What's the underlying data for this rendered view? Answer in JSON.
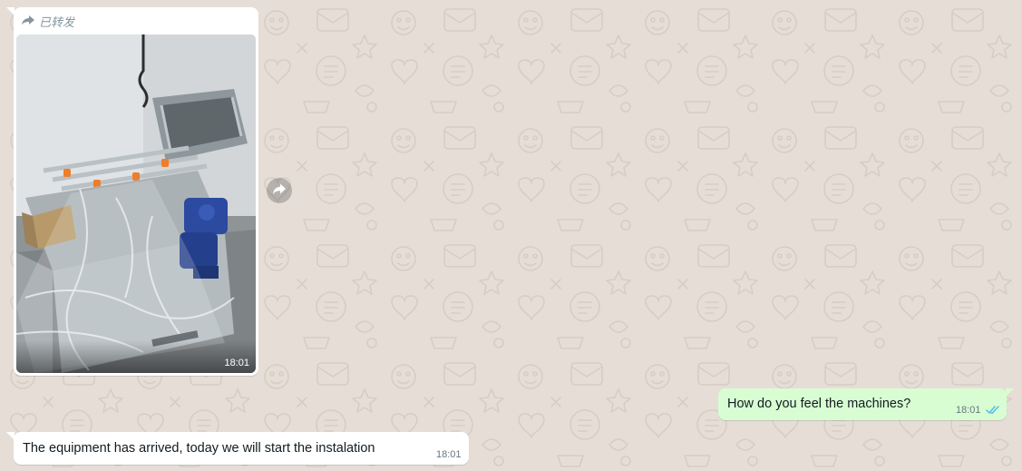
{
  "colors": {
    "wallpaper": "#e6ded6",
    "incoming_bubble": "#ffffff",
    "outgoing_bubble": "#d9fdd3",
    "read_ticks": "#53bdeb",
    "meta_text": "#8696a0"
  },
  "messages": [
    {
      "direction": "incoming",
      "kind": "image",
      "forwarded_label": "已转发",
      "forwarded_icon": "forward-arrow-icon",
      "time": "18:01"
    },
    {
      "direction": "outgoing",
      "kind": "text",
      "text": "How do you feel the machines?",
      "time": "18:01",
      "status_icon": "double-check-read-icon"
    },
    {
      "direction": "incoming",
      "kind": "text",
      "text": "The equipment has arrived, today we will start the instalation",
      "time": "18:01"
    }
  ],
  "actions": {
    "forward_button_icon": "forward-icon"
  }
}
